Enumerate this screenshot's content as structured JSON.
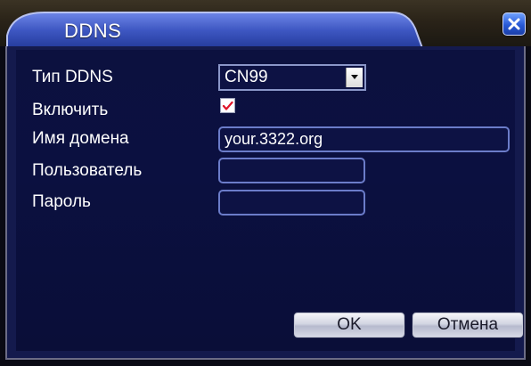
{
  "window": {
    "title": "DDNS"
  },
  "form": {
    "ddns_type": {
      "label": "Тип DDNS",
      "value": "CN99"
    },
    "enable": {
      "label": "Включить",
      "checked": true
    },
    "domain": {
      "label": "Имя домена",
      "value": "your.3322.org"
    },
    "user": {
      "label": "Пользователь",
      "value": ""
    },
    "password": {
      "label": "Пароль",
      "value": ""
    }
  },
  "buttons": {
    "ok_label": "OK",
    "cancel_label": "Отмена"
  },
  "colors": {
    "dialog_background": "#0b1040",
    "field_border": "#6b7cc9",
    "checkmark": "#e0152a",
    "close_button": "#2758d6"
  },
  "icons": {
    "close": "close-icon",
    "dropdown": "chevron-down-icon",
    "check": "checkmark-icon"
  }
}
